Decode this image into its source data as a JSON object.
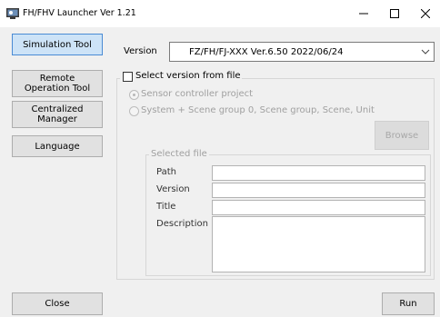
{
  "window": {
    "title": "FH/FHV Launcher Ver 1.21",
    "app_icon": "launcher-app-icon",
    "min_icon": "minimize-icon",
    "max_icon": "maximize-icon",
    "close_icon": "close-icon"
  },
  "sidebar": {
    "items": [
      {
        "label": "Simulation Tool",
        "active": true
      },
      {
        "label": "Remote Operation Tool",
        "active": false
      },
      {
        "label": "Centralized Manager",
        "active": false
      },
      {
        "label": "Language",
        "active": false
      }
    ],
    "close_label": "Close"
  },
  "main": {
    "version_label": "Version",
    "version_value": "FZ/FH/FJ-XXX Ver.6.50 2022/06/24",
    "select_from_file_label": "Select version from file",
    "select_from_file_checked": false,
    "radio_sensor_label": "Sensor controller project",
    "radio_system_label": "System + Scene group 0, Scene group, Scene, Unit",
    "browse_label": "Browse",
    "selected_file": {
      "legend": "Selected file",
      "path_label": "Path",
      "version_label": "Version",
      "title_label": "Title",
      "description_label": "Description",
      "path_value": "",
      "version_value": "",
      "title_value": "",
      "description_value": ""
    },
    "run_label": "Run"
  },
  "colors": {
    "active_button_bg": "#cde3f7",
    "active_button_border": "#4a8bd4",
    "panel_bg": "#f0f0f0",
    "disabled_text": "#a0a0a0"
  }
}
